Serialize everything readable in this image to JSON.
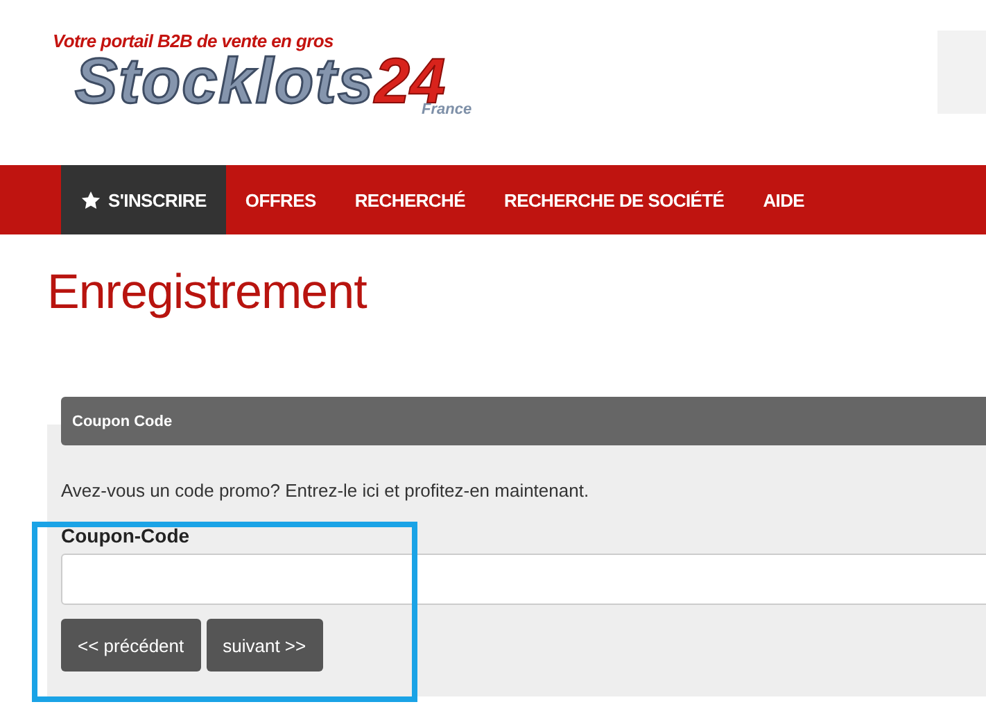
{
  "header": {
    "tagline": "Votre portail B2B de vente en gros",
    "logo": {
      "main": "Stocklots",
      "number": "24",
      "country": "France"
    }
  },
  "nav": {
    "items": [
      {
        "label": "S'INSCRIRE",
        "selected": true
      },
      {
        "label": "OFFRES",
        "selected": false
      },
      {
        "label": "RECHERCHÉ",
        "selected": false
      },
      {
        "label": "RECHERCHE DE SOCIÉTÉ",
        "selected": false
      },
      {
        "label": "AIDE",
        "selected": false
      }
    ]
  },
  "page_title": "Enregistrement",
  "panel": {
    "title": "Coupon Code",
    "intro": "Avez-vous un code promo? Entrez-le ici et profitez-en maintenant.",
    "field": {
      "label": "Coupon-Code"
    },
    "buttons": [
      {
        "label": "<< précédent"
      },
      {
        "label": "suivant >>"
      }
    ]
  }
}
